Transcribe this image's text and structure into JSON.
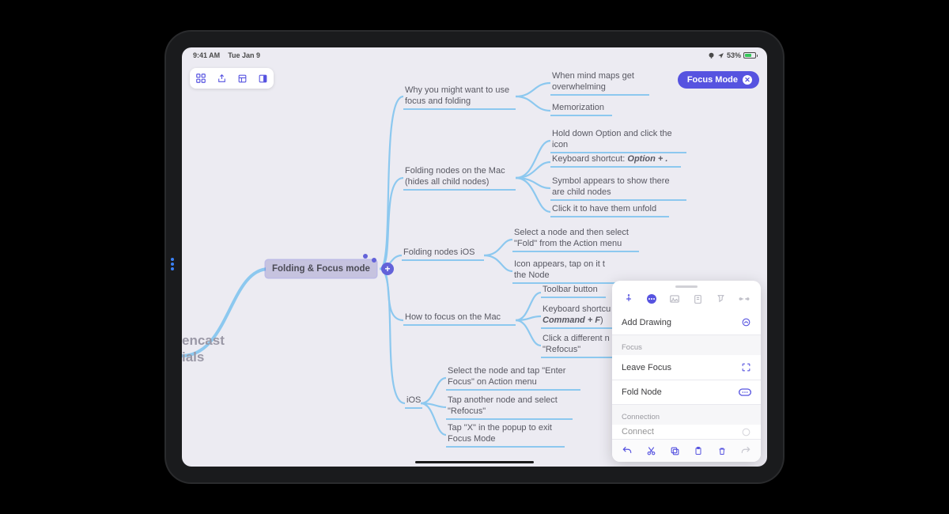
{
  "status": {
    "time": "9:41 AM",
    "date": "Tue Jan 9",
    "battery_pct": "53%"
  },
  "toolbar": {
    "focus_mode_label": "Focus Mode"
  },
  "map": {
    "root_label": "encast\nials",
    "central": "Folding & Focus mode",
    "b1": "Why you might want to use\nfocus and folding",
    "b1_1": "When mind maps get\noverwhelming",
    "b1_2": "Memorization",
    "b2": "Folding nodes on the Mac\n(hides all child nodes)",
    "b2_1": "Hold down Option and click the\nicon",
    "b2_2_pre": "Keyboard shortcut: ",
    "b2_2_kbd": "Option + .",
    "b2_3": "Symbol appears to show there\nare child nodes",
    "b2_4": "Click it to have them unfold",
    "b3": "Folding nodes iOS",
    "b3_1": "Select a node and then select\n\"Fold\" from the Action menu",
    "b3_2": "Icon appears, tap on it t\nthe Node",
    "b4": "How to focus on the Mac",
    "b4_1": "Toolbar button",
    "b4_2_pre": "Keyboard shortcu",
    "b4_2_kbd": "Command + F",
    "b4_2_post": ")",
    "b4_3": "Click a different n\n\"Refocus\"",
    "b5": "iOS",
    "b5_1": "Select the node and tap \"Enter\nFocus\" on Action menu",
    "b5_2": "Tap another node and select\n\"Refocus\"",
    "b5_3": "Tap \"X\" in the popup to exit\nFocus Mode"
  },
  "panel": {
    "add_drawing": "Add Drawing",
    "section_focus": "Focus",
    "leave_focus": "Leave Focus",
    "fold_node": "Fold Node",
    "section_connection": "Connection",
    "connect": "Connect"
  }
}
